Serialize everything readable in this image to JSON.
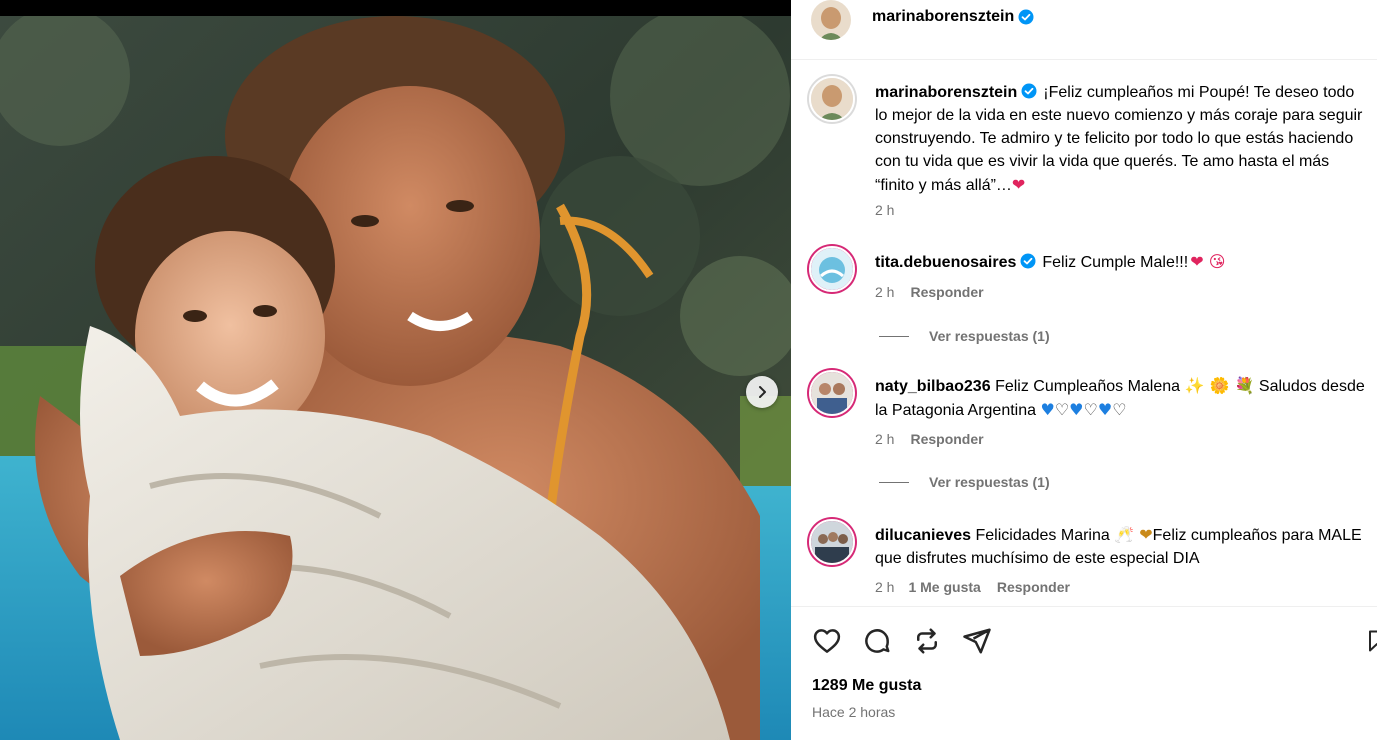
{
  "post": {
    "author": "marinaborensztein",
    "likes_label": "1289 Me gusta",
    "timestamp": "Hace 2 horas"
  },
  "caption": {
    "username": "marinaborensztein",
    "text": "¡Feliz cumpleaños mi Poupé! Te deseo todo lo mejor de la vida en este nuevo comienzo y más coraje para seguir construyendo. Te admiro y te felicito por todo lo que estás haciendo con tu vida que es vivir la vida que querés. Te amo hasta el más “finito y más allá”…",
    "emoji": "❤",
    "time": "2 h"
  },
  "comments": [
    {
      "username": "tita.debuenosaires",
      "verified": true,
      "text": "Feliz Cumple Male!!!",
      "emojis": "❤ 😘",
      "time": "2 h",
      "reply_label": "Responder",
      "view_replies": "Ver respuestas (1)"
    },
    {
      "username": "naty_bilbao236",
      "verified": false,
      "text": "Feliz Cumpleaños Malena",
      "emojis_mid": "✨ 🌼 💐",
      "text2": "Saludos desde la Patagonia Argentina",
      "time": "2 h",
      "reply_label": "Responder",
      "view_replies": "Ver respuestas (1)"
    },
    {
      "username": "dilucanieves",
      "verified": false,
      "text": "Felicidades Marina",
      "emojis_mid": "🥂 ❤",
      "text2": "Feliz cumpleaños para MALE que disfrutes muchísimo de este especial DIA",
      "time": "2 h",
      "likes_label": "1 Me gusta",
      "reply_label": "Responder"
    }
  ],
  "icons": {
    "like": "heart-icon",
    "comment": "comment-icon",
    "share": "repost-icon",
    "send": "send-icon",
    "save": "bookmark-icon",
    "next": "chevron-right-icon",
    "verified": "verified-badge-icon"
  },
  "colors": {
    "verified": "#0095f6",
    "muted_text": "#737373",
    "heart": "#e0245e",
    "blue_heart": "#1d7fe0",
    "story_ring": "#d62976"
  }
}
